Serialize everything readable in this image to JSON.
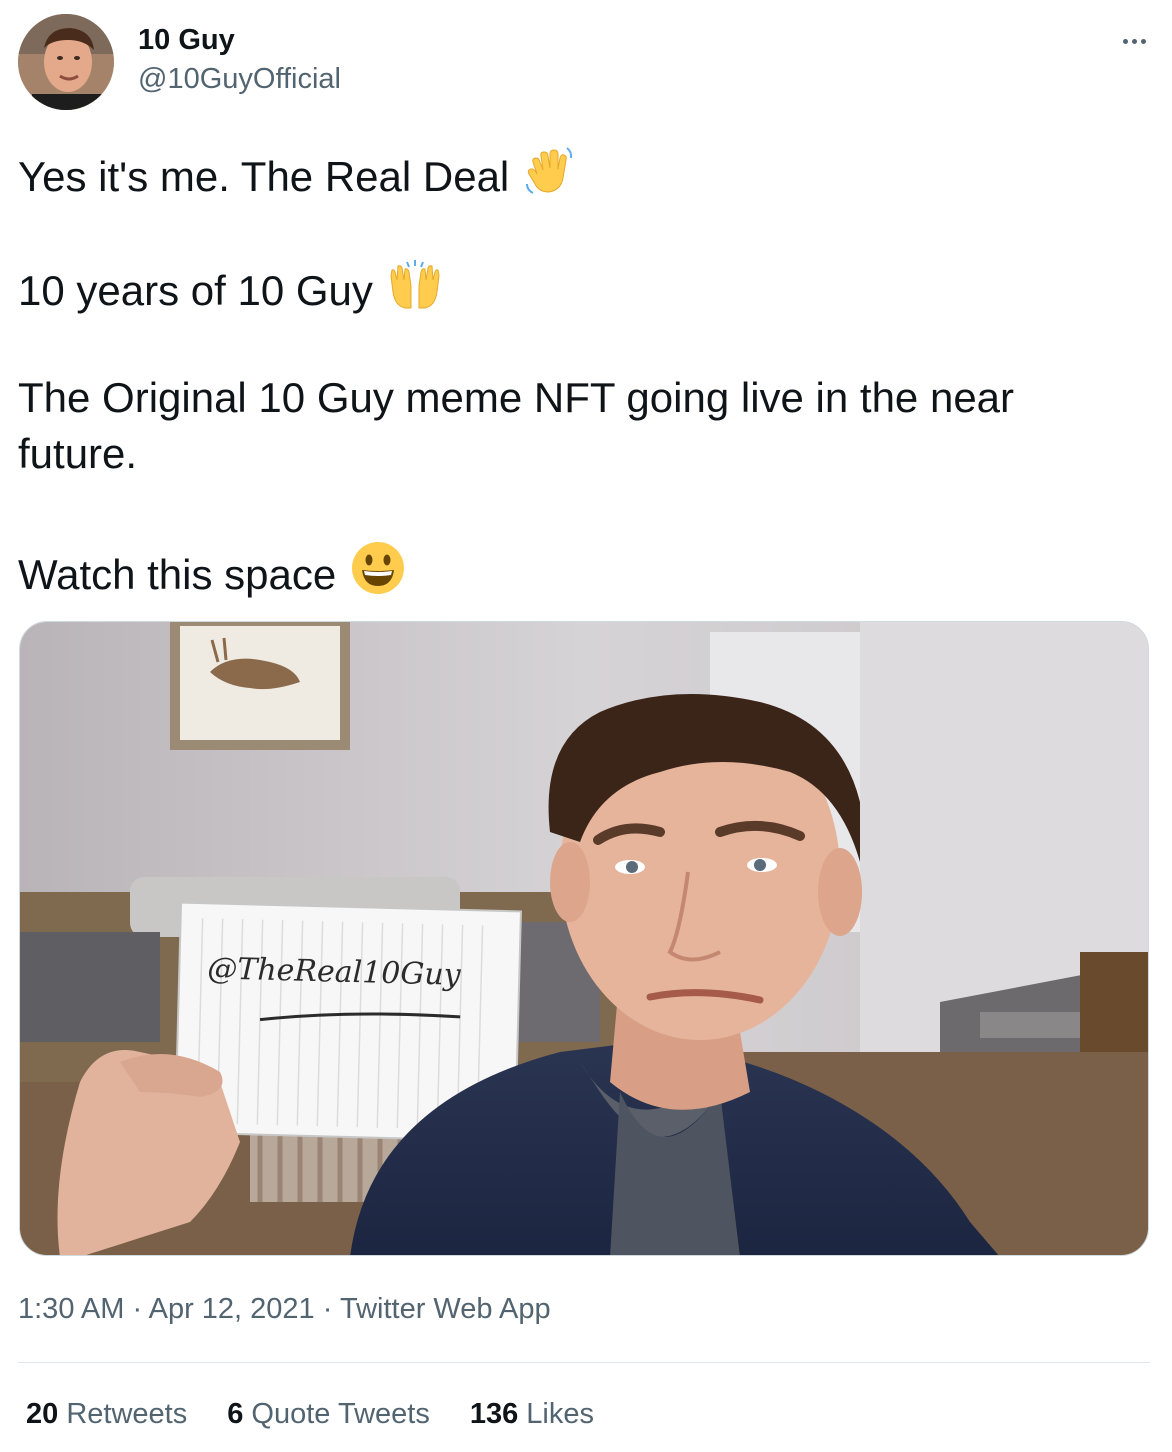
{
  "tweet": {
    "author": {
      "display_name": "10 Guy",
      "handle": "@10GuyOfficial"
    },
    "paragraphs": [
      {
        "text": "Yes it's me. The Real Deal",
        "emoji": "waving-hand"
      },
      {
        "text": "10 years of 10 Guy",
        "emoji": "raising-hands"
      },
      {
        "line1": "The Original 10 Guy meme NFT going live in the near",
        "line2": "future."
      },
      {
        "text": "Watch this space",
        "emoji": "grinning-face"
      }
    ],
    "image": {
      "sign_text": "@TheReal10Guy"
    },
    "time": "1:30 AM",
    "date": "Apr 12, 2021",
    "source": "Twitter Web App",
    "separator": "·",
    "stats": {
      "retweets": {
        "count": "20",
        "label": "Retweets"
      },
      "quotes": {
        "count": "6",
        "label": "Quote Tweets"
      },
      "likes": {
        "count": "136",
        "label": "Likes"
      }
    }
  },
  "colors": {
    "text": "#0f1419",
    "secondary": "#536471",
    "border": "#cfd9de",
    "emoji_yellow": "#ffcc4d"
  }
}
